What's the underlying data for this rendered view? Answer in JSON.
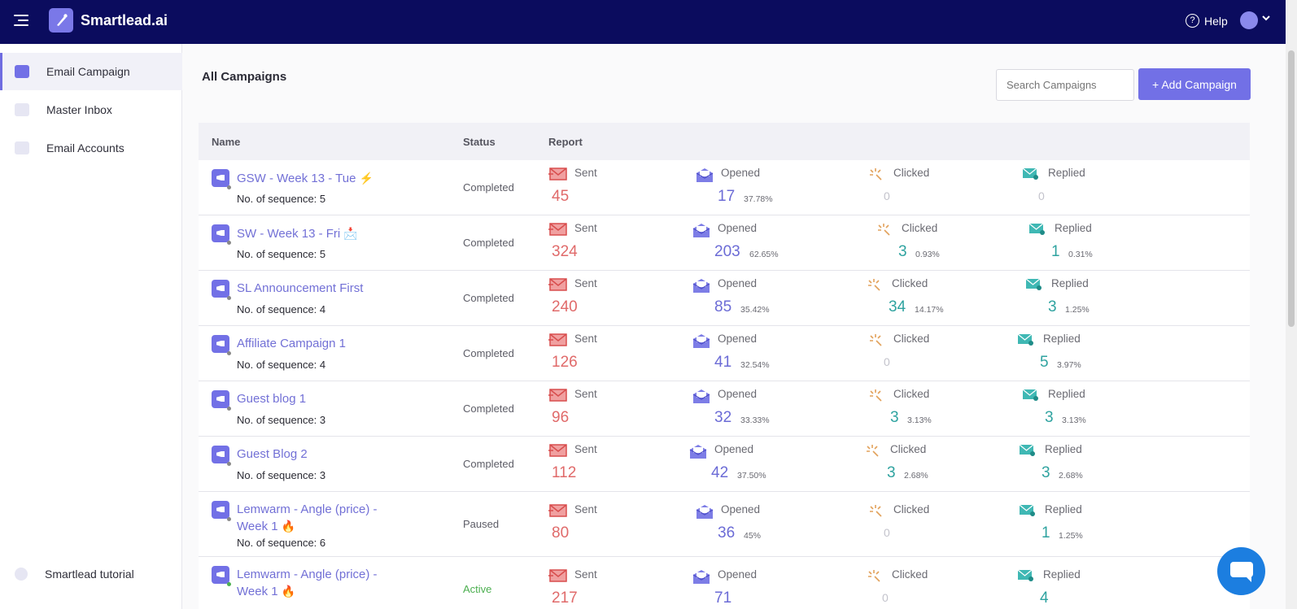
{
  "topbar": {
    "app_name": "Smartlead.ai",
    "help_label": "Help",
    "help_icon": "?",
    "brand_color": "#0b0c5e"
  },
  "sidebar": {
    "items": [
      {
        "label": "Email Campaign",
        "icon": "megaphone-icon",
        "active": true
      },
      {
        "label": "Master Inbox",
        "icon": "inbox-icon",
        "active": false
      },
      {
        "label": "Email Accounts",
        "icon": "mail-accounts-icon",
        "active": false
      }
    ],
    "footer_label": "Smartlead tutorial"
  },
  "main": {
    "title": "All Campaigns",
    "search_placeholder": "Search Campaigns",
    "add_button": "+ Add Campaign",
    "accent_color": "#7270e6"
  },
  "table": {
    "headers": {
      "name": "Name",
      "status": "Status",
      "report": "Report"
    },
    "metric_labels": {
      "sent": "Sent",
      "opened": "Opened",
      "clicked": "Clicked",
      "replied": "Replied"
    },
    "rows": [
      {
        "name": "GSW - Week 13 - Tue",
        "emoji": "⚡",
        "seq": "No. of sequence: 5",
        "status": "Completed",
        "sent": "45",
        "opened": "17",
        "opened_pct": "37.78%",
        "clicked": "0",
        "clicked_pct": "",
        "replied": "0",
        "replied_pct": ""
      },
      {
        "name": "SW - Week 13 - Fri",
        "emoji": "📩",
        "seq": "No. of sequence: 5",
        "status": "Completed",
        "sent": "324",
        "opened": "203",
        "opened_pct": "62.65%",
        "clicked": "3",
        "clicked_pct": "0.93%",
        "replied": "1",
        "replied_pct": "0.31%"
      },
      {
        "name": "SL Announcement First",
        "emoji": "",
        "seq": "No. of sequence: 4",
        "status": "Completed",
        "sent": "240",
        "opened": "85",
        "opened_pct": "35.42%",
        "clicked": "34",
        "clicked_pct": "14.17%",
        "replied": "3",
        "replied_pct": "1.25%"
      },
      {
        "name": "Affiliate Campaign 1",
        "emoji": "",
        "seq": "No. of sequence: 4",
        "status": "Completed",
        "sent": "126",
        "opened": "41",
        "opened_pct": "32.54%",
        "clicked": "0",
        "clicked_pct": "",
        "replied": "5",
        "replied_pct": "3.97%"
      },
      {
        "name": "Guest blog 1",
        "emoji": "",
        "seq": "No. of sequence: 3",
        "status": "Completed",
        "sent": "96",
        "opened": "32",
        "opened_pct": "33.33%",
        "clicked": "3",
        "clicked_pct": "3.13%",
        "replied": "3",
        "replied_pct": "3.13%"
      },
      {
        "name": "Guest Blog 2",
        "emoji": "",
        "seq": "No. of sequence: 3",
        "status": "Completed",
        "sent": "112",
        "opened": "42",
        "opened_pct": "37.50%",
        "clicked": "3",
        "clicked_pct": "2.68%",
        "replied": "3",
        "replied_pct": "2.68%"
      },
      {
        "name": "Lemwarm - Angle (price) - Week 1",
        "emoji": "🔥",
        "seq": "No. of sequence: 6",
        "status": "Paused",
        "sent": "80",
        "opened": "36",
        "opened_pct": "45%",
        "clicked": "0",
        "clicked_pct": "",
        "replied": "1",
        "replied_pct": "1.25%"
      },
      {
        "name": "Lemwarm - Angle (price) - Week 1",
        "emoji": "🔥",
        "seq": "",
        "status": "Active",
        "sent": "217",
        "opened": "71",
        "opened_pct": "",
        "clicked": "0",
        "clicked_pct": "",
        "replied": "4",
        "replied_pct": ""
      }
    ]
  }
}
